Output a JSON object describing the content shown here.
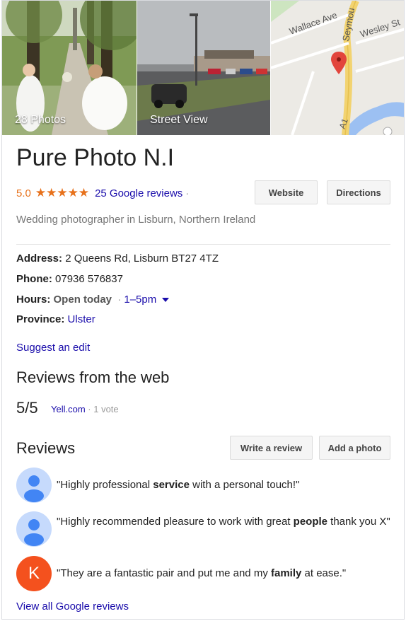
{
  "photos": {
    "photos_label": "28 Photos",
    "street_view_label": "Street View",
    "map": {
      "street1": "Wallace Ave",
      "street2": "Wesley St",
      "street3": "Seymou",
      "road": "A1",
      "pin_icon": "map-pin-icon"
    }
  },
  "business": {
    "name": "Pure Photo N.I",
    "rating": "5.0",
    "stars": "★★★★★",
    "reviews_link": "25 Google reviews",
    "separator": "·",
    "category": "Wedding photographer in Lisburn, Northern Ireland"
  },
  "actions": {
    "website": "Website",
    "directions": "Directions"
  },
  "facts": {
    "address_label": "Address:",
    "address_value": "2 Queens Rd, Lisburn BT27 4TZ",
    "phone_label": "Phone:",
    "phone_value": "07936 576837",
    "hours_label": "Hours:",
    "hours_status": "Open today",
    "hours_sep": "·",
    "hours_value": "1–5pm",
    "province_label": "Province:",
    "province_value": "Ulster"
  },
  "suggest_edit": "Suggest an edit",
  "web_reviews": {
    "title": "Reviews from the web",
    "score": "5/5",
    "source": "Yell.com",
    "votes": "· 1 vote"
  },
  "reviews": {
    "title": "Reviews",
    "write_review": "Write a review",
    "add_photo": "Add a photo",
    "items": [
      {
        "avatar": "person-icon",
        "before": "\"Highly professional ",
        "bold": "service",
        "after": " with a personal touch!\""
      },
      {
        "avatar": "person-icon",
        "before": "\"Highly recommended pleasure to work with great ",
        "bold": "people",
        "after": " thank you X\""
      },
      {
        "avatar_letter": "K",
        "before": "\"They are a fantastic pair and put me and my ",
        "bold": "family",
        "after": " at ease.\""
      }
    ],
    "view_all": "View all Google reviews"
  },
  "colors": {
    "accent_orange": "#e7711b",
    "link_blue": "#1a0dab",
    "avatar_k": "#f4511e"
  }
}
